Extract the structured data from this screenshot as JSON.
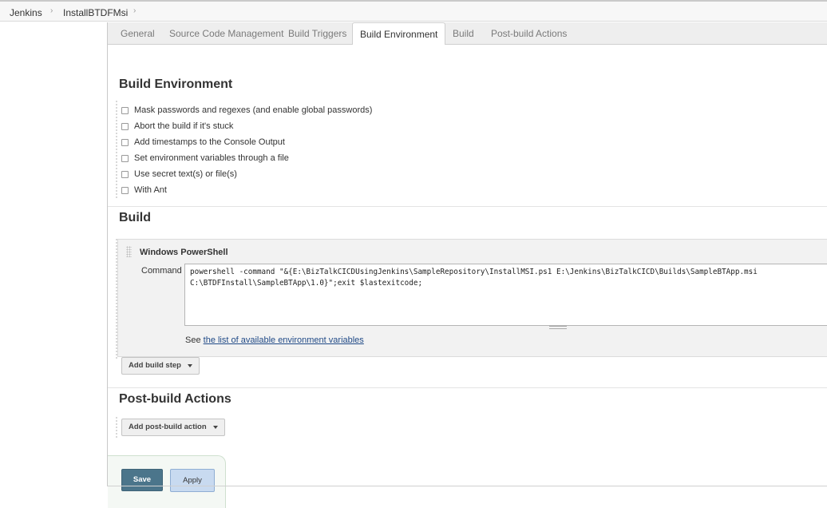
{
  "breadcrumb": {
    "items": [
      "Jenkins",
      "InstallBTDFMsi"
    ],
    "separator": "›"
  },
  "tabs": [
    {
      "label": "General",
      "active": false
    },
    {
      "label": "Source Code Management",
      "active": false
    },
    {
      "label": "Build Triggers",
      "active": false
    },
    {
      "label": "Build Environment",
      "active": true
    },
    {
      "label": "Build",
      "active": false
    },
    {
      "label": "Post-build Actions",
      "active": false
    }
  ],
  "build_environment": {
    "title": "Build Environment",
    "options": [
      {
        "label": "Mask passwords and regexes (and enable global passwords)",
        "checked": false
      },
      {
        "label": "Abort the build if it's stuck",
        "checked": false
      },
      {
        "label": "Add timestamps to the Console Output",
        "checked": false
      },
      {
        "label": "Set environment variables through a file",
        "checked": false
      },
      {
        "label": "Use secret text(s) or file(s)",
        "checked": false
      },
      {
        "label": "With Ant",
        "checked": false
      }
    ]
  },
  "build": {
    "title": "Build",
    "step": {
      "title": "Windows PowerShell",
      "command_label": "Command",
      "command_value": "powershell -command \"&{E:\\BizTalkCICDUsingJenkins\\SampleRepository\\InstallMSI.ps1 E:\\Jenkins\\BizTalkCICD\\Builds\\SampleBTApp.msi\nC:\\BTDFInstall\\SampleBTApp\\1.0}\";exit $lastexitcode;",
      "see_prefix": "See ",
      "see_link": "the list of available environment variables"
    },
    "add_step_label": "Add build step"
  },
  "post_build": {
    "title": "Post-build Actions",
    "add_action_label": "Add post-build action"
  },
  "actions": {
    "save_label": "Save",
    "apply_label": "Apply"
  },
  "colors": {
    "save_button": "#4b758b",
    "apply_button": "#c8daf0",
    "link": "#204a87"
  }
}
